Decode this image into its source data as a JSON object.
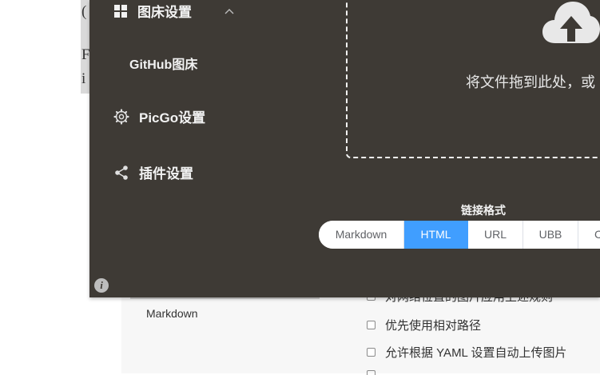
{
  "background": {
    "left_fragments": [
      "(",
      "F",
      "i"
    ],
    "sidebar_label": "Markdown",
    "options": [
      {
        "label": "对网络位置的图片应用上述规则",
        "checked": false
      },
      {
        "label": "优先使用相对路径",
        "checked": false
      },
      {
        "label": "允许根据 YAML 设置自动上传图片",
        "checked": false
      }
    ]
  },
  "picgo": {
    "nav": {
      "imgbed": {
        "label": "图床设置",
        "icon": "grid-icon"
      },
      "github": {
        "label": "GitHub图床"
      },
      "settings": {
        "label": "PicGo设置",
        "icon": "gear-icon"
      },
      "plugins": {
        "label": "插件设置",
        "icon": "share-icon"
      }
    },
    "info_icon": "i",
    "upload": {
      "icon": "cloud-upload-icon",
      "text": "将文件拖到此处，或"
    },
    "link_format": {
      "title": "链接格式",
      "options": [
        "Markdown",
        "HTML",
        "URL",
        "UBB",
        "C"
      ],
      "selected": "HTML"
    }
  },
  "colors": {
    "window_bg": "#3e3a35",
    "accent": "#409eff",
    "text_light": "#f2f2f2"
  }
}
